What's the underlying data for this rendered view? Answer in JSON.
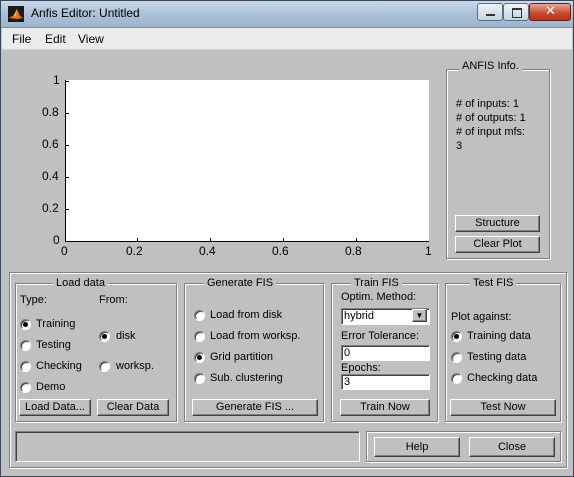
{
  "window": {
    "title": "Anfis Editor: Untitled"
  },
  "menu": {
    "items": [
      "File",
      "Edit",
      "View"
    ]
  },
  "plot": {
    "x_ticks": [
      "0",
      "0.2",
      "0.4",
      "0.6",
      "0.8",
      "1"
    ],
    "y_ticks": [
      "0",
      "0.2",
      "0.4",
      "0.6",
      "0.8",
      "1"
    ]
  },
  "anfis_info": {
    "title": "ANFIS Info.",
    "lines": [
      "# of inputs: 1",
      "# of outputs: 1",
      "# of input mfs:",
      "3"
    ],
    "structure_label": "Structure",
    "clear_plot_label": "Clear Plot"
  },
  "load_data": {
    "title": "Load data",
    "type_label": "Type:",
    "from_label": "From:",
    "types": [
      {
        "label": "Training",
        "selected": true
      },
      {
        "label": "Testing",
        "selected": false
      },
      {
        "label": "Checking",
        "selected": false
      },
      {
        "label": "Demo",
        "selected": false
      }
    ],
    "sources": [
      {
        "label": "disk",
        "selected": true
      },
      {
        "label": "worksp.",
        "selected": false
      }
    ],
    "load_button": "Load Data...",
    "clear_button": "Clear Data"
  },
  "generate_fis": {
    "title": "Generate FIS",
    "options": [
      {
        "label": "Load from disk",
        "selected": false
      },
      {
        "label": "Load from worksp.",
        "selected": false
      },
      {
        "label": "Grid partition",
        "selected": true
      },
      {
        "label": "Sub. clustering",
        "selected": false
      }
    ],
    "button": "Generate FIS ..."
  },
  "train_fis": {
    "title": "Train FIS",
    "method_label": "Optim. Method:",
    "method_value": "hybrid",
    "error_label": "Error Tolerance:",
    "error_value": "0",
    "epochs_label": "Epochs:",
    "epochs_value": "3",
    "button": "Train Now"
  },
  "test_fis": {
    "title": "Test FIS",
    "plot_against_label": "Plot against:",
    "options": [
      {
        "label": "Training data",
        "selected": true
      },
      {
        "label": "Testing data",
        "selected": false
      },
      {
        "label": "Checking data",
        "selected": false
      }
    ],
    "button": "Test Now"
  },
  "footer": {
    "status_text": "",
    "help_label": "Help",
    "close_label": "Close"
  }
}
